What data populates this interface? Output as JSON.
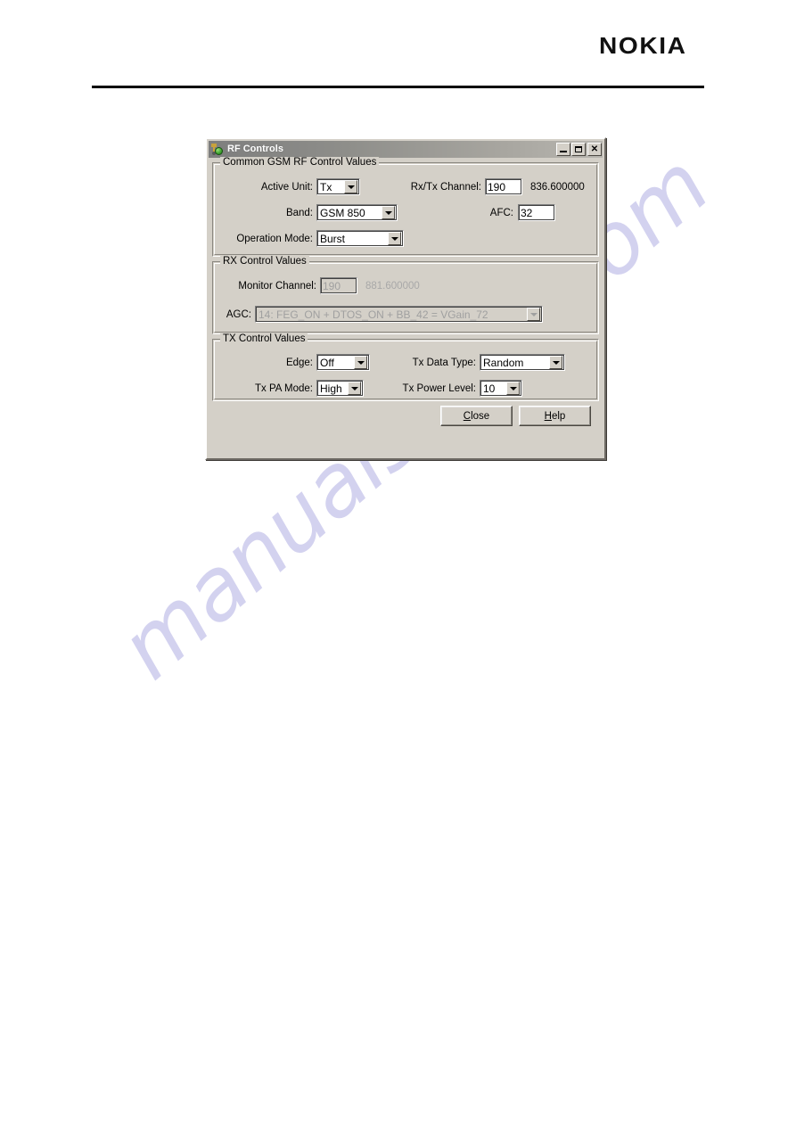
{
  "page": {
    "brand": "NOKIA"
  },
  "watermark": {
    "text": "manualshive.com",
    "color": "#b9b7e6"
  },
  "dialog": {
    "title": "RF Controls",
    "icon": "rf-controls-icon",
    "window_buttons": {
      "minimize": "minimize-icon",
      "maximize": "maximize-icon",
      "close": "✕"
    },
    "groups": {
      "common": {
        "title": "Common GSM RF Control Values",
        "active_unit": {
          "label": "Active Unit:",
          "value": "Tx"
        },
        "band": {
          "label": "Band:",
          "value": "GSM 850"
        },
        "operation_mode": {
          "label": "Operation Mode:",
          "value": "Burst"
        },
        "rx_tx_channel": {
          "label": "Rx/Tx Channel:",
          "value": "190",
          "frequency": "836.600000"
        },
        "afc": {
          "label": "AFC:",
          "value": "32"
        }
      },
      "rx": {
        "title": "RX Control Values",
        "monitor_channel": {
          "label": "Monitor Channel:",
          "value": "190",
          "frequency": "881.600000"
        },
        "agc": {
          "label": "AGC:",
          "value": "14: FEG_ON + DTOS_ON + BB_42 = VGain_72"
        }
      },
      "tx": {
        "title": "TX Control Values",
        "edge": {
          "label": "Edge:",
          "value": "Off"
        },
        "tx_pa_mode": {
          "label": "Tx PA Mode:",
          "value": "High"
        },
        "tx_data_type": {
          "label": "Tx Data Type:",
          "value": "Random"
        },
        "tx_power_level": {
          "label": "Tx Power Level:",
          "value": "10"
        }
      }
    },
    "buttons": {
      "close": {
        "accel": "C",
        "rest": "lose"
      },
      "help": {
        "accel": "H",
        "rest": "elp"
      }
    }
  }
}
